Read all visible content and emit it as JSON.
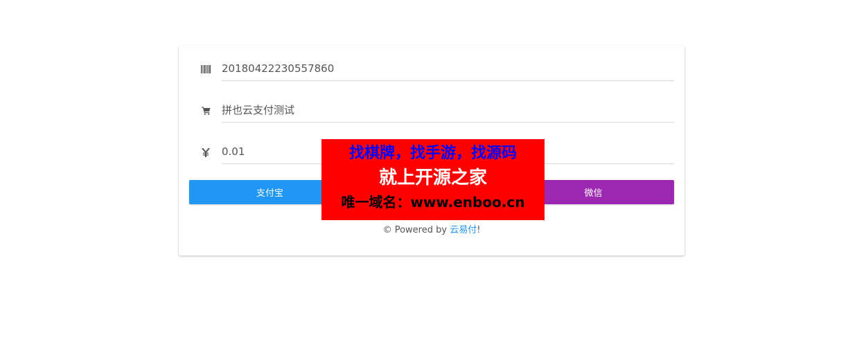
{
  "form": {
    "order_no": "20180422230557860",
    "product_name": "拼也云支付测试",
    "amount": "0.01"
  },
  "buttons": {
    "alipay": "支付宝",
    "qq": "",
    "wechat": "微信"
  },
  "footer": {
    "prefix": "© Powered by ",
    "link": "云易付",
    "suffix": "!"
  },
  "overlay": {
    "line1": "找棋牌，找手游，找源码",
    "line2": "就上开源之家",
    "line3": "唯一域名：www.enboo.cn"
  },
  "icons": {
    "barcode": "barcode-icon",
    "cart": "shopping-cart-icon",
    "yen": "yen-icon"
  },
  "colors": {
    "alipay": "#2196f3",
    "wechat": "#9c27b0",
    "link": "#2196f3",
    "overlay_bg": "#ff0000",
    "overlay_line1": "#0000ff"
  }
}
